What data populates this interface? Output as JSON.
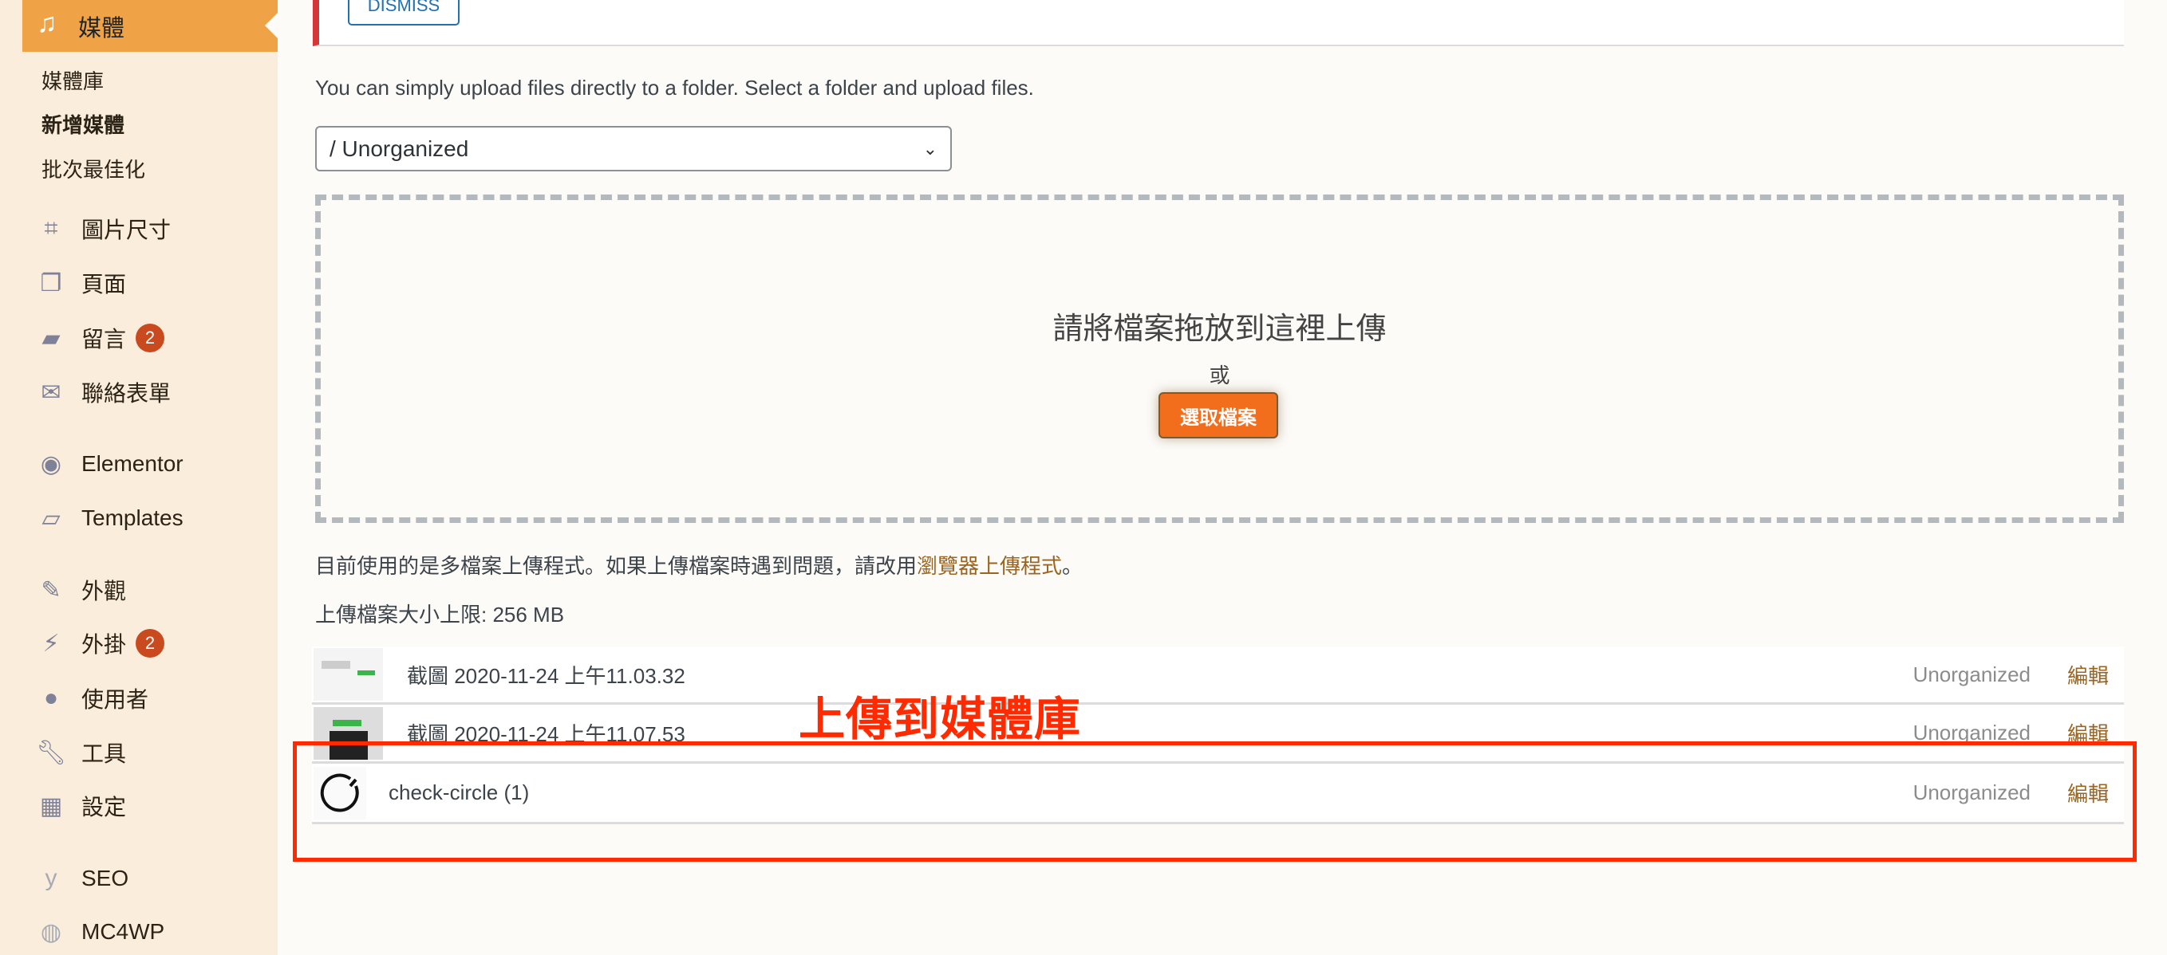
{
  "sidebar": {
    "active": {
      "label": "媒體",
      "icon": "media-icon"
    },
    "submenu": [
      "媒體庫",
      "新增媒體",
      "批次最佳化"
    ],
    "items": [
      {
        "label": "圖片尺寸",
        "icon": "crop-icon"
      },
      {
        "label": "頁面",
        "icon": "pages-icon"
      },
      {
        "label": "留言",
        "icon": "comment-icon",
        "badge": "2"
      },
      {
        "label": "聯絡表單",
        "icon": "mail-icon"
      },
      {
        "label": "Elementor",
        "icon": "elementor-icon"
      },
      {
        "label": "Templates",
        "icon": "folder-icon"
      },
      {
        "label": "外觀",
        "icon": "brush-icon"
      },
      {
        "label": "外掛",
        "icon": "plugin-icon",
        "badge": "2"
      },
      {
        "label": "使用者",
        "icon": "user-icon"
      },
      {
        "label": "工具",
        "icon": "wrench-icon"
      },
      {
        "label": "設定",
        "icon": "settings-icon"
      },
      {
        "label": "SEO",
        "icon": "yoast-icon"
      },
      {
        "label": "MC4WP",
        "icon": "mc4wp-icon"
      }
    ]
  },
  "notice": {
    "dismiss": "DISMISS"
  },
  "main": {
    "intro": "You can simply upload files directly to a folder. Select a folder and upload files.",
    "folder_select": "/ Unorganized",
    "drop_title": "請將檔案拖放到這裡上傳",
    "drop_or": "或",
    "select_files": "選取檔案",
    "uploader_note": "目前使用的是多檔案上傳程式。如果上傳檔案時遇到問題，請改用",
    "uploader_link": "瀏覽器上傳程式",
    "uploader_end": "。",
    "max_size": "上傳檔案大小上限: 256 MB",
    "files": [
      {
        "name": "截圖 2020-11-24 上午11.03.32",
        "folder": "Unorganized",
        "edit": "編輯"
      },
      {
        "name": "截圖 2020-11-24 上午11.07.53",
        "folder": "Unorganized",
        "edit": "編輯"
      },
      {
        "name": "check-circle (1)",
        "folder": "Unorganized",
        "edit": "編輯"
      }
    ]
  },
  "annotation": {
    "label": "上傳到媒體庫",
    "color": "#ff2a00"
  }
}
